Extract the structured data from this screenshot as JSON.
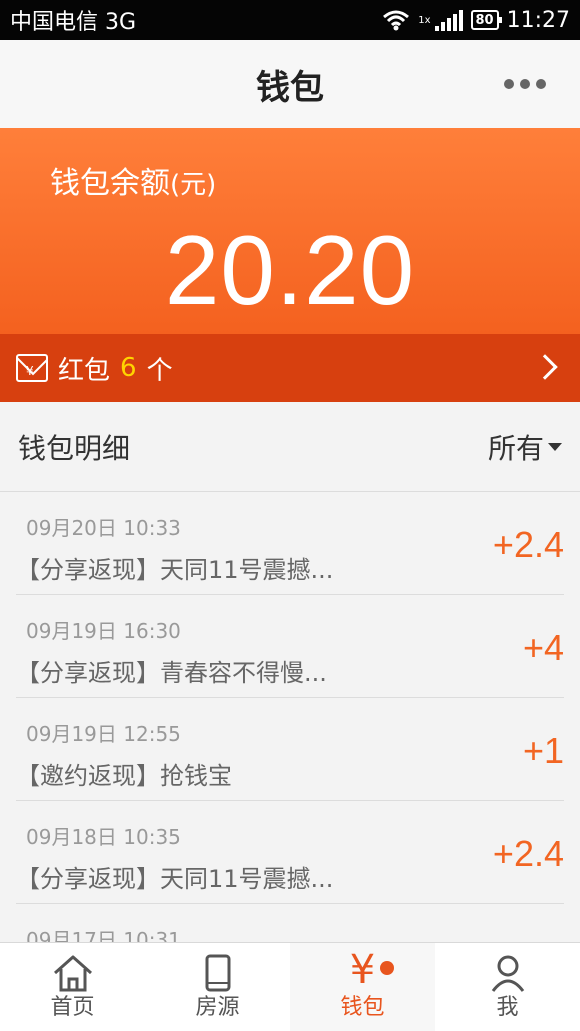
{
  "status": {
    "carrier": "中国电信 3G",
    "net": "1x",
    "battery": "80",
    "time": "11:27"
  },
  "header": {
    "title": "钱包"
  },
  "balance": {
    "label": "钱包余额",
    "unit": "(元)",
    "amount": "20.20"
  },
  "redpack": {
    "label": "红包",
    "count": "6",
    "unit": "个"
  },
  "detail": {
    "title": "钱包明细",
    "filter": "所有"
  },
  "records": [
    {
      "date": "09月20日 10:33",
      "desc": "【分享返现】天同11号震撼...",
      "amount": "+2.4"
    },
    {
      "date": "09月19日 16:30",
      "desc": "【分享返现】青春容不得慢...",
      "amount": "+4"
    },
    {
      "date": "09月19日 12:55",
      "desc": "【邀约返现】抢钱宝",
      "amount": "+1"
    },
    {
      "date": "09月18日 10:35",
      "desc": "【分享返现】天同11号震撼...",
      "amount": "+2.4"
    },
    {
      "date": "09月17日 10:31",
      "desc": "",
      "amount": ""
    }
  ],
  "tabs": [
    {
      "label": "首页",
      "icon": "home-icon"
    },
    {
      "label": "房源",
      "icon": "phone-icon"
    },
    {
      "label": "钱包",
      "icon": "yen-icon"
    },
    {
      "label": "我",
      "icon": "person-icon"
    }
  ],
  "colors": {
    "accent": "#f26522",
    "banner": "#ff7f3a",
    "redpack_bar": "#d7400f",
    "count_yellow": "#ffd400"
  }
}
